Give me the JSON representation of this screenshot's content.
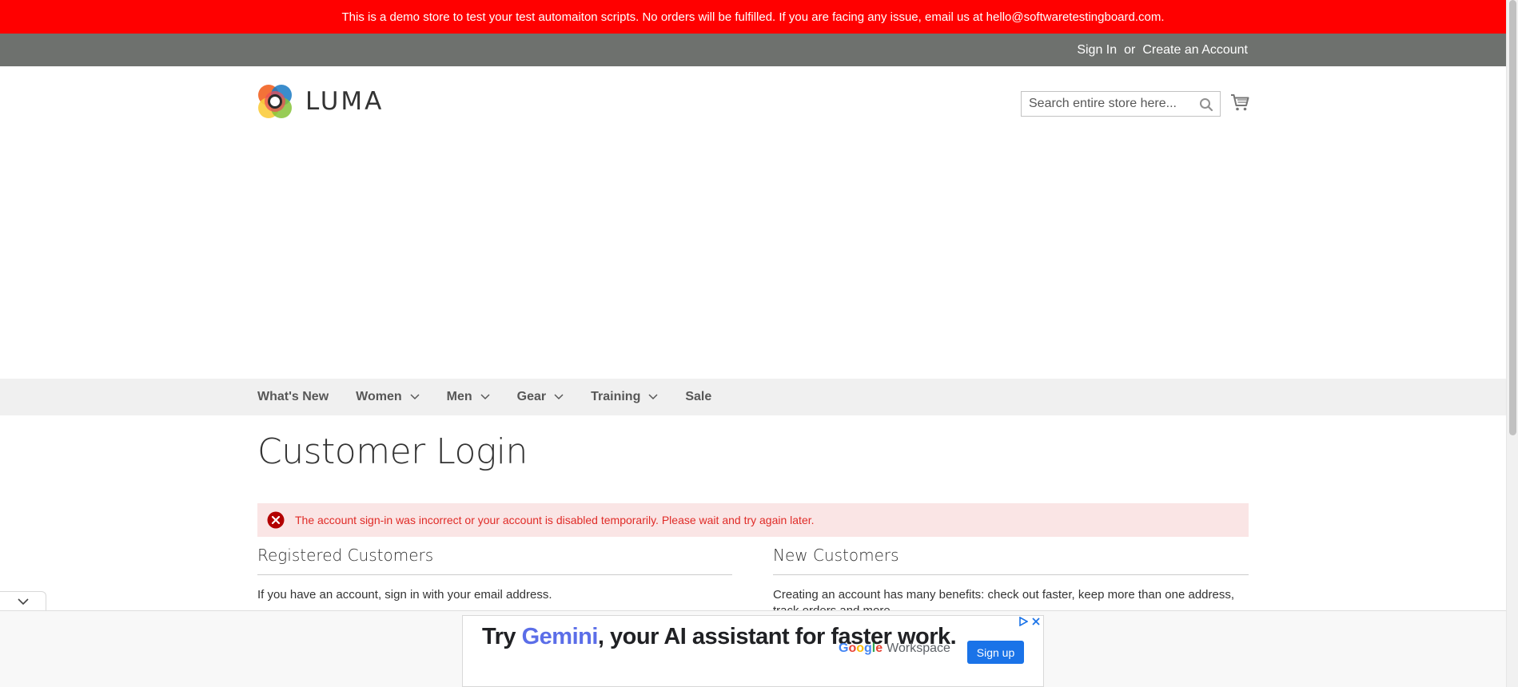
{
  "demo_notice": "This is a demo store to test your test automaiton scripts. No orders will be fulfilled. If you are facing any issue, email us at hello@softwaretestingboard.com.",
  "header": {
    "sign_in": "Sign In",
    "or": "or",
    "create_account": "Create an Account"
  },
  "logo": {
    "text": "LUMA",
    "icon": "luma-logo-icon"
  },
  "search": {
    "placeholder": "Search entire store here...",
    "icon": "search-icon"
  },
  "cart": {
    "icon": "cart-icon"
  },
  "nav": {
    "items": [
      {
        "label": "What's New",
        "has_dropdown": false
      },
      {
        "label": "Women",
        "has_dropdown": true
      },
      {
        "label": "Men",
        "has_dropdown": true
      },
      {
        "label": "Gear",
        "has_dropdown": true
      },
      {
        "label": "Training",
        "has_dropdown": true
      },
      {
        "label": "Sale",
        "has_dropdown": false
      }
    ]
  },
  "page_title": "Customer Login",
  "error_message": "The account sign-in was incorrect or your account is disabled temporarily. Please wait and try again later.",
  "registered": {
    "title": "Registered Customers",
    "text": "If you have an account, sign in with your email address."
  },
  "new_customers": {
    "title": "New Customers",
    "text": "Creating an account has many benefits: check out faster, keep more than one address, track orders and more."
  },
  "ad": {
    "headline_prefix": "Try ",
    "headline_highlight": "Gemini",
    "headline_suffix": ", your AI assistant for faster work.",
    "brand_google": "Google",
    "brand_workspace": "Workspace",
    "cta": "Sign up"
  },
  "colors": {
    "demo_bar": "#ff0000",
    "panel_header": "#6e716e",
    "nav_bg": "#f0f0f0",
    "error_bg": "#fae5e5",
    "error_text": "#e02b27",
    "ad_cta": "#1a73e8"
  }
}
